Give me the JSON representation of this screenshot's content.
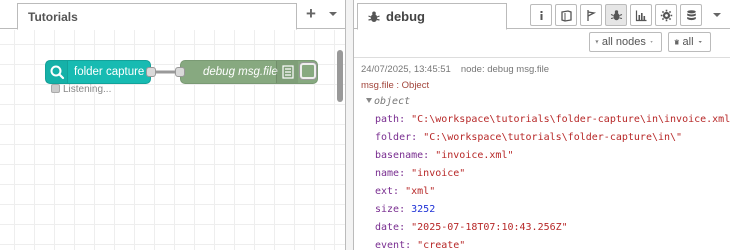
{
  "workspace": {
    "tab_label": "Tutorials",
    "add_label": "+",
    "nodes": {
      "input_label": "folder capture",
      "output_label": "debug msg.file",
      "status_text": "Listening..."
    }
  },
  "sidebar": {
    "tab_label": "debug",
    "icons": [
      "info-icon",
      "book-icon",
      "flag-icon",
      "bug-icon",
      "chart-icon",
      "gear-icon",
      "database-icon"
    ],
    "filter_label": "all nodes",
    "clear_label": "all",
    "message": {
      "timestamp": "24/07/2025, 13:45:51",
      "node": "node: debug msg.file",
      "topic": "msg.file : Object",
      "root": "object",
      "properties": [
        {
          "key": "path:",
          "value": "\"C:\\workspace\\tutorials\\folder-capture\\in\\invoice.xml\"",
          "type": "string"
        },
        {
          "key": "folder:",
          "value": "\"C:\\workspace\\tutorials\\folder-capture\\in\\\"",
          "type": "string"
        },
        {
          "key": "basename:",
          "value": "\"invoice.xml\"",
          "type": "string"
        },
        {
          "key": "name:",
          "value": "\"invoice\"",
          "type": "string"
        },
        {
          "key": "ext:",
          "value": "\"xml\"",
          "type": "string"
        },
        {
          "key": "size:",
          "value": "3252",
          "type": "number"
        },
        {
          "key": "date:",
          "value": "\"2025-07-18T07:10:43.256Z\"",
          "type": "string"
        },
        {
          "key": "event:",
          "value": "\"create\"",
          "type": "string"
        }
      ]
    }
  },
  "colors": {
    "input_node": "#17bbb2",
    "debug_node": "#87a980",
    "key": "#792e90",
    "string": "#b72828",
    "number": "#2033d6"
  }
}
